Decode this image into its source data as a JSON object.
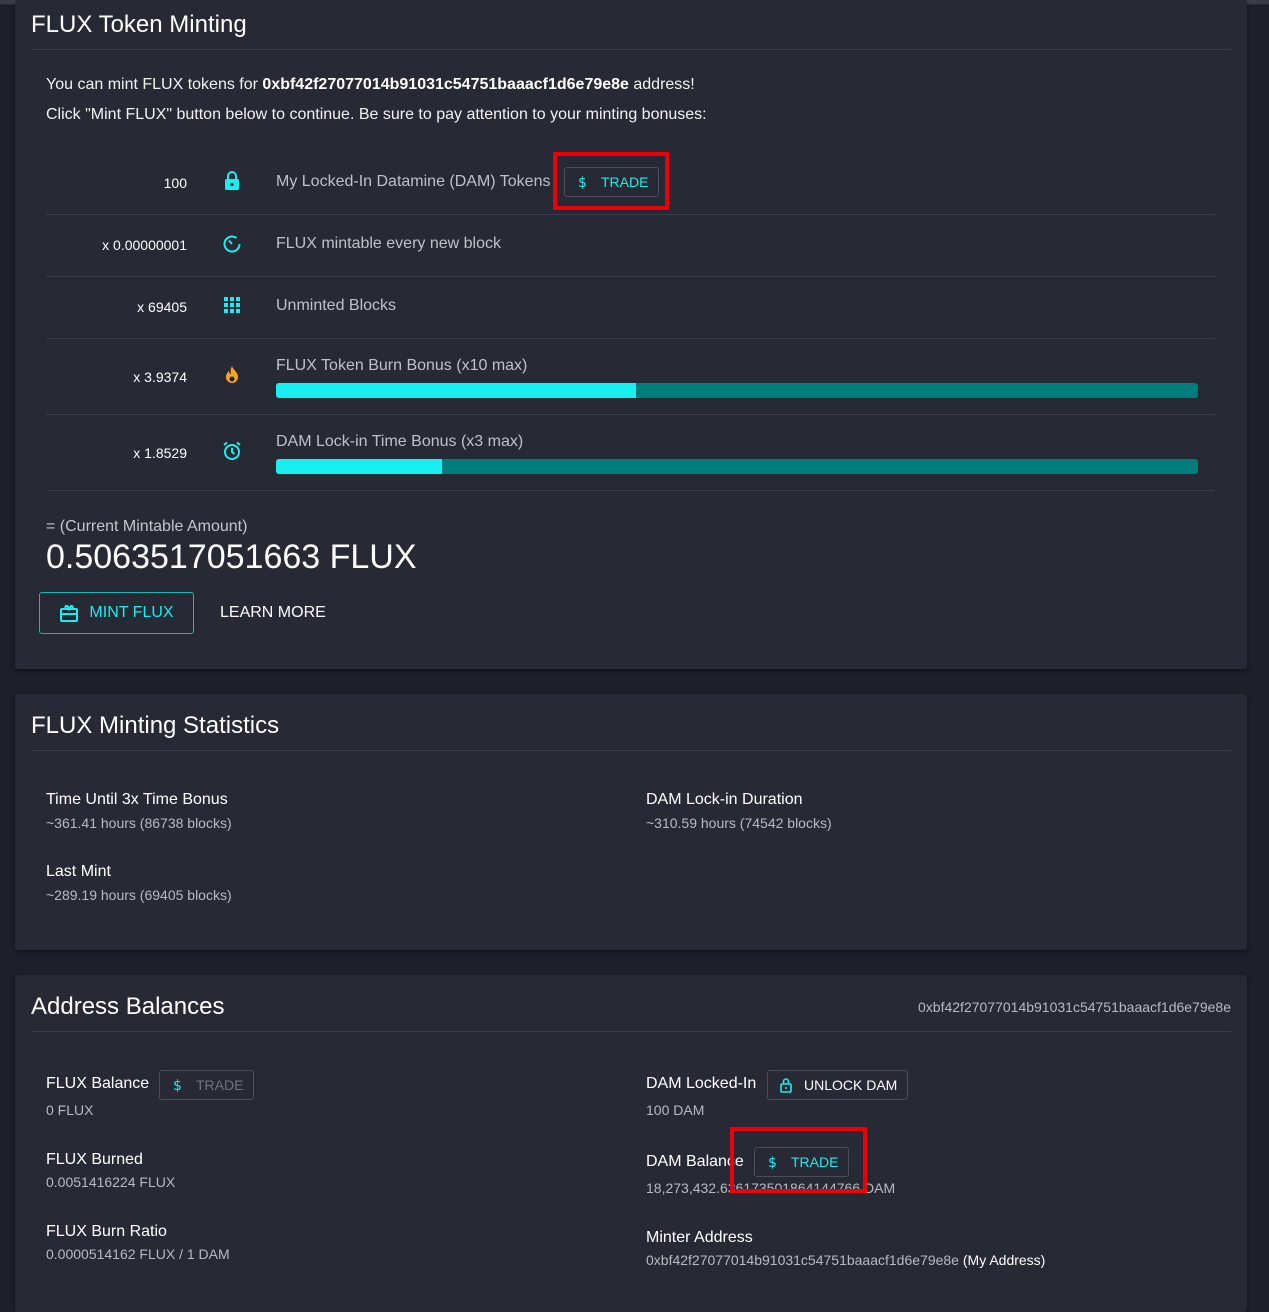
{
  "minting": {
    "title": "FLUX Token Minting",
    "intro1_prefix": "You can mint FLUX tokens for ",
    "intro1_address": "0xbf42f27077014b91031c54751baaacf1d6e79e8e",
    "intro1_suffix": " address!",
    "intro2": "Click \"Mint FLUX\" button below to continue. Be sure to pay attention to your minting bonuses:",
    "rows": [
      {
        "value": "100",
        "icon": "lock-icon",
        "label": "My Locked-In Datamine (DAM) Tokens",
        "button": "TRADE"
      },
      {
        "value": "x 0.00000001",
        "icon": "timer-icon",
        "label": "FLUX mintable every new block"
      },
      {
        "value": "x 69405",
        "icon": "grid-icon",
        "label": "Unminted Blocks"
      },
      {
        "value": "x 3.9374",
        "icon": "fire-icon",
        "label": "FLUX Token Burn Bonus (x10 max)",
        "progress": 0.39
      },
      {
        "value": "x 1.8529",
        "icon": "alarm-icon",
        "label": "DAM Lock-in Time Bonus (x3 max)",
        "progress": 0.18
      }
    ],
    "amount_label": "= (Current Mintable Amount)",
    "amount": "0.5063517051663 FLUX",
    "mint_button": "MINT FLUX",
    "learn_more": "LEARN MORE"
  },
  "stats": {
    "title": "FLUX Minting Statistics",
    "items": [
      {
        "label": "Time Until 3x Time Bonus",
        "value": "~361.41 hours (86738 blocks)"
      },
      {
        "label": "DAM Lock-in Duration",
        "value": "~310.59 hours (74542 blocks)"
      },
      {
        "label": "Last Mint",
        "value": "~289.19 hours (69405 blocks)"
      }
    ]
  },
  "balances": {
    "title": "Address Balances",
    "address": "0xbf42f27077014b91031c54751baaacf1d6e79e8e",
    "flux_balance_label": "FLUX Balance",
    "flux_balance_button": "TRADE",
    "flux_balance_value": "0 FLUX",
    "flux_burned_label": "FLUX Burned",
    "flux_burned_value": "0.0051416224 FLUX",
    "burn_ratio_label": "FLUX Burn Ratio",
    "burn_ratio_value": "0.0000514162 FLUX / 1 DAM",
    "dam_locked_label": "DAM Locked-In",
    "unlock_button": "UNLOCK DAM",
    "dam_locked_value": "100 DAM",
    "dam_balance_label": "DAM Balance",
    "dam_balance_button": "TRADE",
    "dam_balance_value": "18,273,432.636173501864144766 DAM",
    "minter_label": "Minter Address",
    "minter_value": "0xbf42f27077014b91031c54751baaacf1d6e79e8e",
    "minter_suffix": " (My Address)"
  },
  "colors": {
    "accent": "#19eef0",
    "progress_track": "#007c7a",
    "fire": "#f5a623",
    "highlight": "#e8000b",
    "card": "#272935",
    "background": "#1e2029"
  }
}
